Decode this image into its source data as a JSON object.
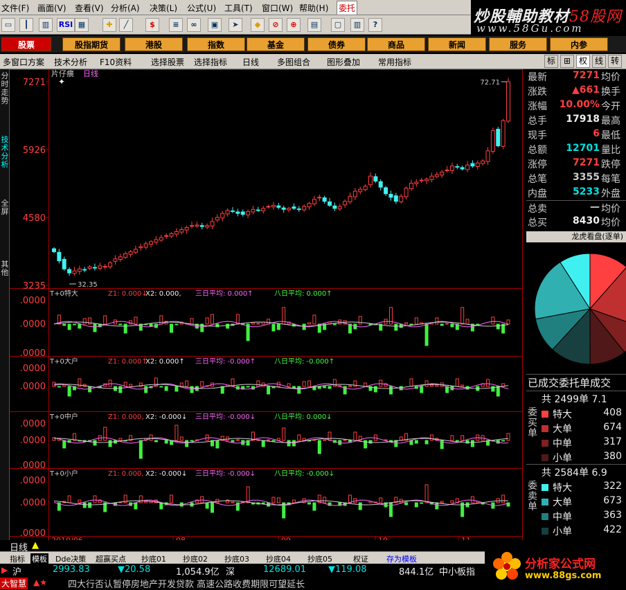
{
  "menu": [
    "文件(F)",
    "画面(V)",
    "查看(V)",
    "分析(A)",
    "决策(L)",
    "公式(U)",
    "工具(T)",
    "窗口(W)",
    "帮助(H)",
    "委托"
  ],
  "brand": {
    "line1_a": "炒股輔助教材",
    "line1_b": "58股网",
    "line2": "www.58Gu.com"
  },
  "toolbar_icons": [
    "open-icon",
    "candle-icon",
    "volume-icon",
    "rsi-icon",
    "grid-icon",
    "cross-icon",
    "ruler-icon",
    "dollar-icon",
    "list-icon",
    "binoculars-icon",
    "chip-icon",
    "arrow-icon",
    "diamond-icon",
    "no-icon",
    "link-icon",
    "doc-icon",
    "window-icon",
    "book-icon",
    "help-icon"
  ],
  "toolbar_labels": {
    "rsi": "RSI",
    "dollar": "$"
  },
  "categories": [
    "股票",
    "股指期货",
    "港股",
    "指数",
    "基金",
    "债券",
    "商品",
    "新闻",
    "服务",
    "内参"
  ],
  "subbar": {
    "items": [
      "多窗口方案",
      "技术分析",
      "F10资料",
      "选择股票",
      "选择指标",
      "日线",
      "多图组合",
      "图形叠加",
      "常用指标"
    ],
    "toggles": [
      "标",
      "⊞",
      "权",
      "线",
      "转"
    ]
  },
  "leftnav": [
    "分时走势",
    "技术分析",
    "全屏",
    "其他"
  ],
  "chart": {
    "title": "片仔癀",
    "period": "日线",
    "price_axis": [
      "7271",
      "5926",
      "4580",
      "3235"
    ],
    "high_label": "72.71",
    "low_label": "32.35",
    "date_axis": [
      "2010/06",
      "08",
      "09",
      "10",
      "11"
    ],
    "bottom_label": "日线",
    "panels": [
      {
        "name": "T+0特大",
        "z1": "Z1: 0.000↓",
        "x2": "X2: 0.000,",
        "m3": "三日平均: 0.000↑",
        "m8": "八日平均: 0.000↑",
        "axis": [
          ".0000",
          ".0000",
          ".0000"
        ]
      },
      {
        "name": "T+0大户",
        "z1": "Z1: 0.000↑",
        "x2": "X2: 0.000↑",
        "m3": "三日平均: -0.000↑",
        "m8": "八日平均: -0.000↑",
        "axis": [
          ".0000",
          ".0000"
        ]
      },
      {
        "name": "T+0中户",
        "z1": "Z1: 0.000,",
        "x2": "X2: -0.000↓",
        "m3": "三日平均: -0.000↓",
        "m8": "八日平均: 0.000↓",
        "axis": [
          ".0000",
          ".0000",
          ".0000"
        ]
      },
      {
        "name": "T+0小户",
        "z1": "Z1: 0.000,",
        "x2": "X2: -0.000↓",
        "m3": "三日平均: -0.000↓",
        "m8": "八日平均: -0.000↓",
        "axis": [
          ".0000",
          ".0000",
          ".0000"
        ]
      }
    ]
  },
  "chart_data": {
    "type": "candlestick",
    "ylim": [
      3235,
      7271
    ],
    "closes": [
      3900,
      3720,
      3560,
      3480,
      3520,
      3560,
      3540,
      3600,
      3580,
      3620,
      3610,
      3680,
      3760,
      3800,
      3860,
      3900,
      3950,
      4000,
      4060,
      4100,
      4140,
      4180,
      4220,
      4260,
      4300,
      4340,
      4380,
      4420,
      4430,
      4400,
      4420,
      4500,
      4580,
      4660,
      4720,
      4700,
      4660,
      4640,
      4700,
      4740,
      4720,
      4760,
      4800,
      4820,
      4780,
      4740,
      4760,
      4760,
      4740,
      4800,
      4860,
      4940,
      4980,
      4900,
      4820,
      4760,
      4800,
      4900,
      5000,
      5100,
      5140,
      5200,
      5400,
      5300,
      5180,
      5050,
      4980,
      4900,
      5000,
      5160,
      5260,
      5280,
      5320,
      5340,
      5400,
      5430,
      5480,
      5520,
      5600,
      5580,
      5540,
      5620,
      5600,
      5660,
      5700,
      5900,
      6300,
      6000,
      6500,
      7271
    ]
  },
  "quote": {
    "rows": [
      {
        "l1": "最新",
        "v1": "7271",
        "c": "up",
        "l2": "均价"
      },
      {
        "l1": "涨跌",
        "v1": "▲661",
        "c": "up",
        "l2": "换手"
      },
      {
        "l1": "涨幅",
        "v1": "10.00%",
        "c": "up",
        "l2": "今开"
      },
      {
        "l1": "总手",
        "v1": "17918",
        "c": "wh",
        "l2": "最高"
      },
      {
        "l1": "现手",
        "v1": "6",
        "c": "up",
        "l2": "最低"
      },
      {
        "l1": "总额",
        "v1": "12701",
        "c": "dn",
        "l2": "量比"
      },
      {
        "l1": "涨停",
        "v1": "7271",
        "c": "up",
        "l2": "跌停"
      },
      {
        "l1": "总笔",
        "v1": "3355",
        "c": "gy",
        "l2": "每笔"
      },
      {
        "l1": "内盘",
        "v1": "5233",
        "c": "dn",
        "l2": "外盘"
      },
      {
        "l1": "总卖",
        "v1": "—",
        "c": "gy",
        "l2": "均价"
      },
      {
        "l1": "总买",
        "v1": "8430",
        "c": "wh",
        "l2": "均价"
      }
    ],
    "pie_title": "龙虎看盘(逐单)",
    "pie_colors": [
      "#ff4040",
      "#c03030",
      "#802020",
      "#501818",
      "#40f0f0",
      "#30b0b0",
      "#208080",
      "#184040"
    ],
    "order_header": "已成交委托单成交",
    "buy": {
      "side": "委买单",
      "total": "共 2499单 7.1",
      "rows": [
        {
          "n": "特大",
          "v": "408",
          "c": "#ff4040"
        },
        {
          "n": "大单",
          "v": "674",
          "c": "#c03030"
        },
        {
          "n": "中单",
          "v": "317",
          "c": "#802020"
        },
        {
          "n": "小单",
          "v": "380",
          "c": "#501818"
        }
      ]
    },
    "sell": {
      "side": "委卖单",
      "total": "共 2584单 6.9",
      "rows": [
        {
          "n": "特大",
          "v": "322",
          "c": "#40f0f0"
        },
        {
          "n": "大单",
          "v": "673",
          "c": "#30b0b0"
        },
        {
          "n": "中单",
          "v": "363",
          "c": "#208080"
        },
        {
          "n": "小单",
          "v": "422",
          "c": "#184040"
        }
      ]
    }
  },
  "bottom_tabs": [
    "指标",
    "模板",
    "Dde决策",
    "超赢买点",
    "抄底01",
    "抄底02",
    "抄底03",
    "抄底04",
    "抄底05",
    "权证",
    "存为模板"
  ],
  "status": {
    "sh_label": "沪",
    "sh_val": "2993.83",
    "sh_chg": "▼20.58",
    "sh_amt": "1,054.9亿",
    "sz_label": "深",
    "sz_val": "12689.01",
    "sz_chg": "▼119.08",
    "sz_amt": "844.1亿",
    "board": "中小板指",
    "news": "四大行否认暂停房地产开发贷款 高速公路收费期限可望延长",
    "app": "大智慧"
  },
  "logo": {
    "text": "分析家公式网",
    "url": "www.88gs.com"
  }
}
